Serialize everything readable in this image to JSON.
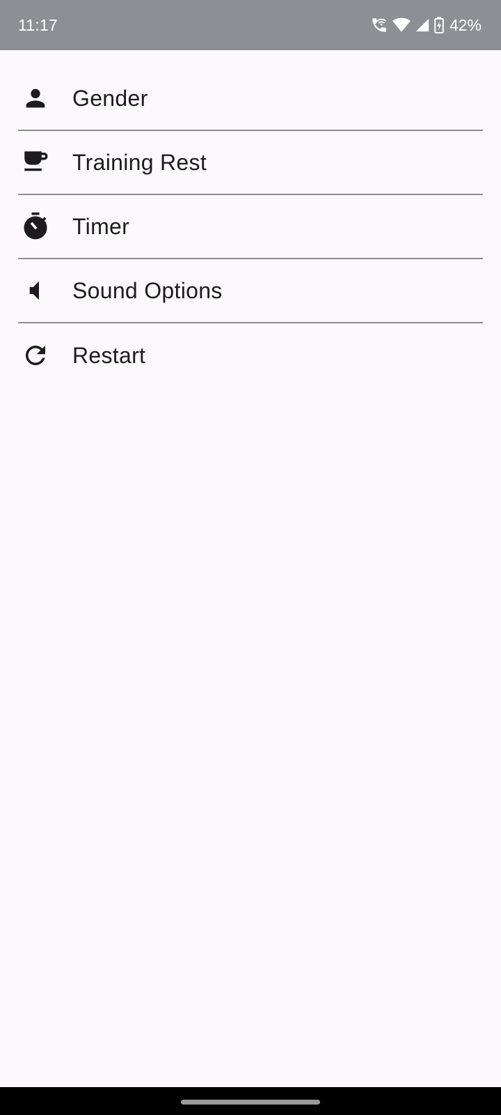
{
  "status_bar": {
    "time": "11:17",
    "battery_percent": "42%",
    "icons": [
      "wifi-call-icon",
      "wifi-icon",
      "cellular-signal-icon",
      "battery-charging-icon"
    ]
  },
  "menu": {
    "items": [
      {
        "label": "Gender",
        "icon": "person-icon"
      },
      {
        "label": "Training Rest",
        "icon": "coffee-cup-icon"
      },
      {
        "label": "Timer",
        "icon": "stopwatch-icon"
      },
      {
        "label": "Sound Options",
        "icon": "volume-icon"
      },
      {
        "label": "Restart",
        "icon": "refresh-icon"
      }
    ]
  },
  "colors": {
    "status_bar_bg": "#8e8f95",
    "page_bg": "#fdf8fc",
    "divider": "#8d8d90",
    "text": "#1c1b1f",
    "icon": "#1c1b1f",
    "nav_bar_bg": "#000000"
  }
}
